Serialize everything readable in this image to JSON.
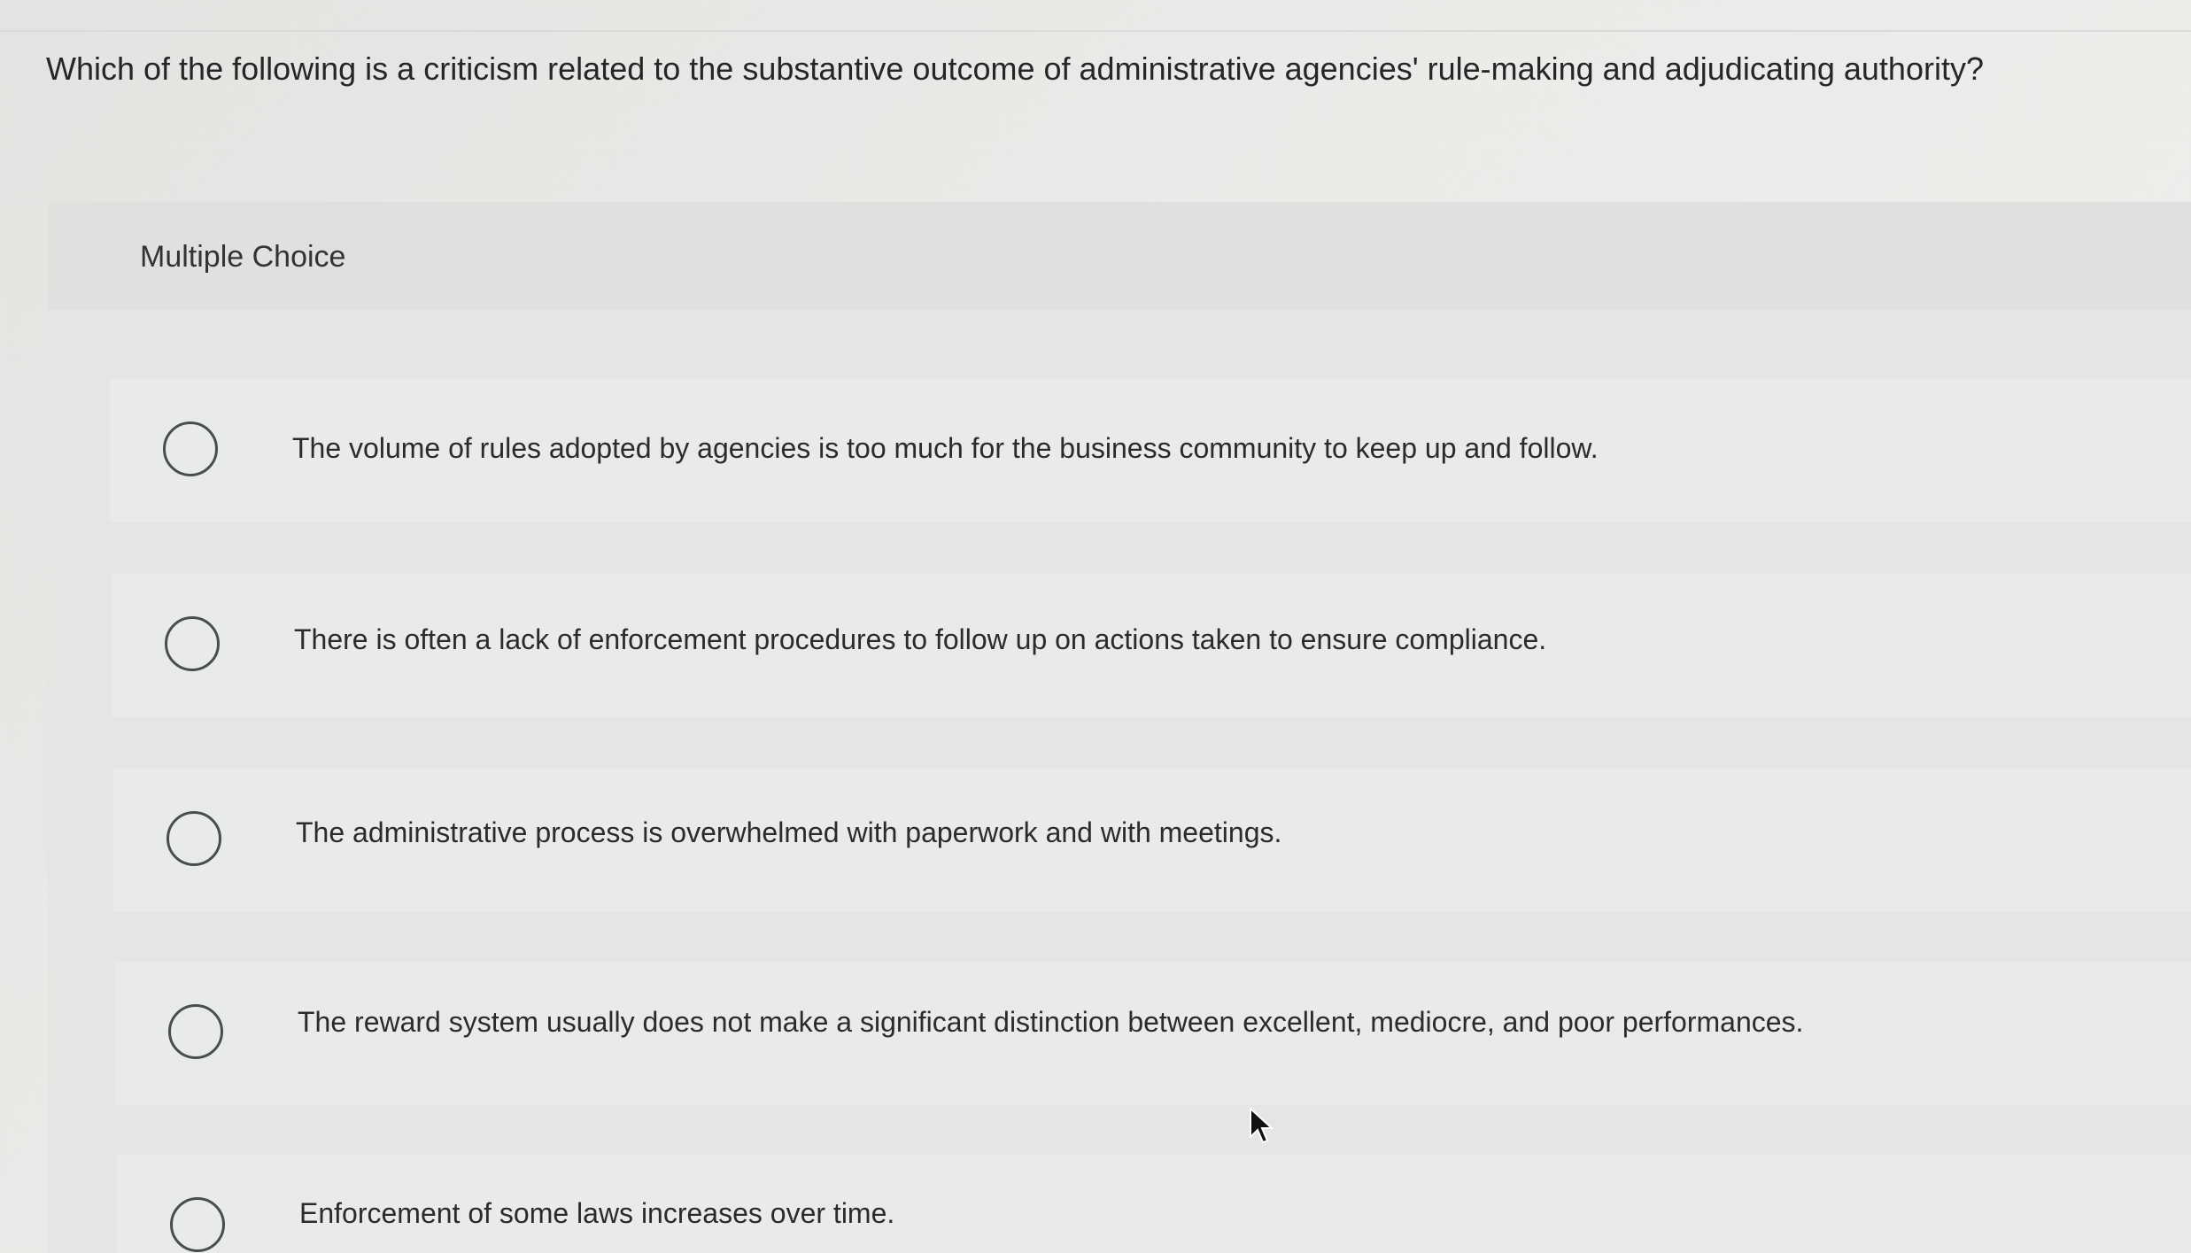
{
  "question": {
    "text": "Which of the following is a criticism related to the substantive outcome of administrative agencies' rule-making and adjudicating authority?"
  },
  "panel": {
    "label": "Multiple Choice"
  },
  "options": [
    {
      "label": "The volume of rules adopted by agencies is too much for the business community to keep up and follow.",
      "selected": false
    },
    {
      "label": "There is often a lack of enforcement procedures to follow up on actions taken to ensure compliance.",
      "selected": false
    },
    {
      "label": "The administrative process is overwhelmed with paperwork and with meetings.",
      "selected": false
    },
    {
      "label": "The reward system usually does not make a significant distinction between excellent, mediocre, and poor performances.",
      "selected": false
    },
    {
      "label": "Enforcement of some laws increases over time.",
      "selected": false
    }
  ],
  "icons": {
    "radio": "radio-unchecked-icon",
    "cursor": "mouse-pointer-icon"
  }
}
